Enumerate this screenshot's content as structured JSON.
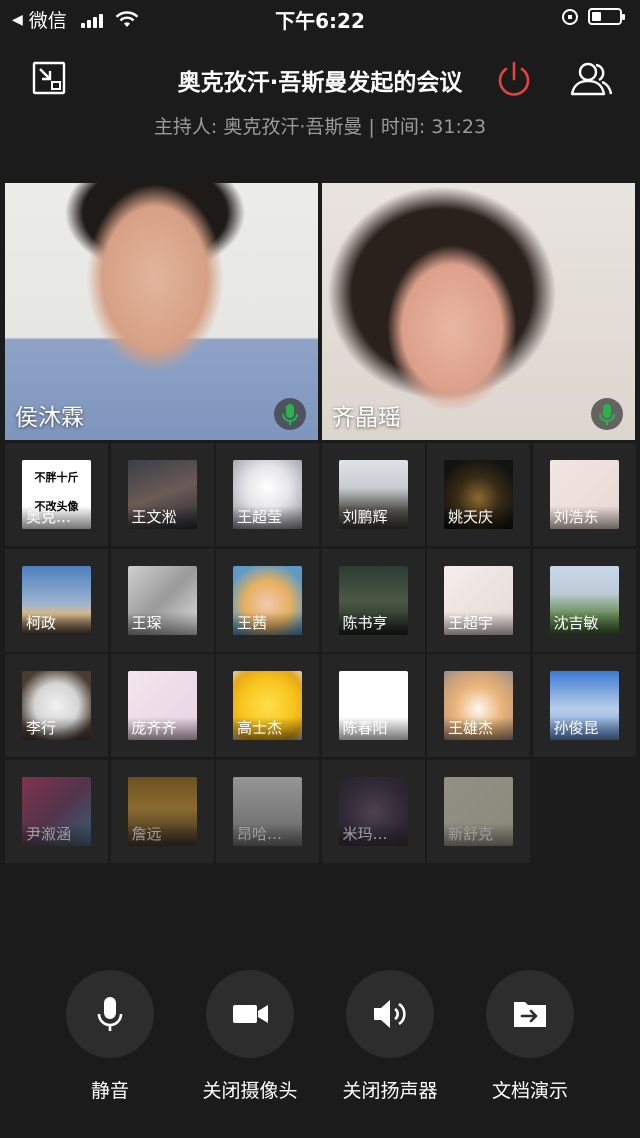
{
  "status_bar": {
    "back_app": "微信",
    "time": "下午6:22",
    "battery_level": 0.35,
    "icons": [
      "back-arrow-icon",
      "signal-icon",
      "wifi-icon",
      "rotation-lock-icon",
      "battery-icon"
    ]
  },
  "header": {
    "title": "奥克孜汗·吾斯曼发起的会议",
    "subtitle": "主持人: 奥克孜汗·吾斯曼 | 时间: 31:23",
    "icons": [
      "minimize-window-icon",
      "power-icon",
      "participants-icon"
    ],
    "power_color": "#e2453c"
  },
  "videos": [
    {
      "name": "侯沐霖",
      "mic": "mic-active-icon"
    },
    {
      "name": "齐晶瑶",
      "mic": "mic-active-icon"
    }
  ],
  "accent_green": "#2bb24c",
  "participants": [
    {
      "name": "奥克…",
      "avatar_text": [
        "不胖十斤",
        "不改头像"
      ]
    },
    {
      "name": "王文淞"
    },
    {
      "name": "王超莹"
    },
    {
      "name": "刘鹏辉"
    },
    {
      "name": "姚天庆"
    },
    {
      "name": "刘浩东"
    },
    {
      "name": "柯政"
    },
    {
      "name": "王琛"
    },
    {
      "name": "王茜"
    },
    {
      "name": "陈书亨"
    },
    {
      "name": "王超宇"
    },
    {
      "name": "沈吉敏"
    },
    {
      "name": "李行"
    },
    {
      "name": "庞齐齐"
    },
    {
      "name": "高士杰"
    },
    {
      "name": "陈春阳"
    },
    {
      "name": "王雄杰"
    },
    {
      "name": "孙俊昆"
    },
    {
      "name": "尹溆涵"
    },
    {
      "name": "詹远"
    },
    {
      "name": "昂哈…"
    },
    {
      "name": "米玛…"
    },
    {
      "name": "新舒克"
    }
  ],
  "controls": [
    {
      "label": "静音",
      "icon": "microphone-icon"
    },
    {
      "label": "关闭摄像头",
      "icon": "video-camera-icon"
    },
    {
      "label": "关闭扬声器",
      "icon": "speaker-icon"
    },
    {
      "label": "文档演示",
      "icon": "share-document-icon"
    }
  ]
}
